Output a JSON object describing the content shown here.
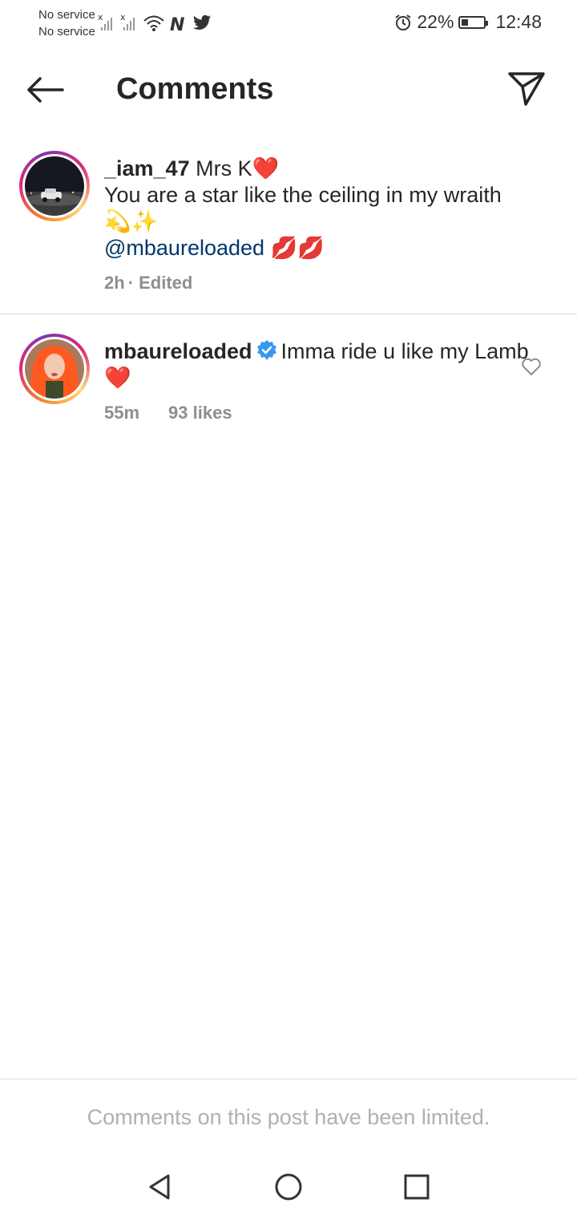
{
  "status_bar": {
    "carrier1": "No service",
    "carrier2": "No service",
    "battery": "22%",
    "time": "12:48",
    "icons": [
      "signal-icon",
      "signal-icon",
      "wifi-icon",
      "nfc-icon",
      "twitter-icon",
      "alarm-icon",
      "battery-icon"
    ]
  },
  "header": {
    "title": "Comments"
  },
  "comments": [
    {
      "username": "_iam_47",
      "text": "Mrs K❤️",
      "line2": "You are a star like the ceiling in my wraith",
      "line3": "💫✨",
      "mention": "@mbaureloaded",
      "mention_suffix": " 💋💋",
      "time": "2h",
      "edited": "· Edited"
    },
    {
      "username": "mbaureloaded",
      "text": "Imma ride u like my Lamb ❤️",
      "time": "55m",
      "likes": "93 likes"
    }
  ],
  "footer": {
    "limited_text": "Comments on this post have been limited."
  },
  "colors": {
    "mention": "#00376b",
    "meta": "#8e8e8e",
    "verified": "#3897f0"
  }
}
